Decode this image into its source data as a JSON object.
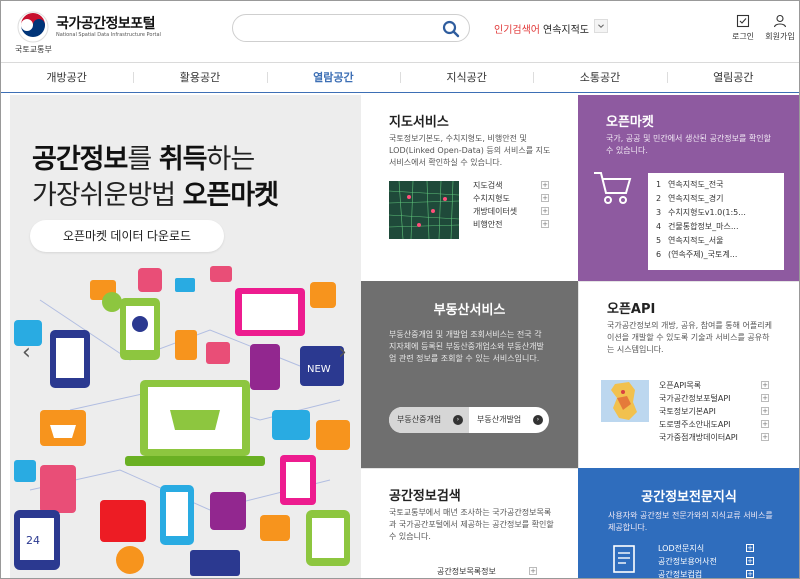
{
  "header": {
    "ministry": "국토교통부",
    "title": "국가공간정보포털",
    "subtitle": "National Spatial Data Infrastructure Portal",
    "search_value": "",
    "popular_label": "인기검색어",
    "popular_value": "연속지적도",
    "login_label": "로그인",
    "join_label": "회원가입"
  },
  "nav": [
    "개방공간",
    "활용공간",
    "열람공간",
    "지식공간",
    "소통공간",
    "열림공간"
  ],
  "hero": {
    "line1_bold1": "공간정보",
    "line1_rest1": "를 ",
    "line1_bold2": "취득",
    "line1_rest2": "하는",
    "line2_rest": "가장쉬운방법 ",
    "line2_bold": "오픈마켓",
    "button": "오픈마켓 데이터 다운로드",
    "prev": "‹",
    "next": "›"
  },
  "map_service": {
    "title": "지도서비스",
    "desc": "국토정보기본도, 수치지형도, 비행안전 및 LOD(Linked Open-Data) 등의 서비스를 지도서비스에서 확인하실 수 있습니다.",
    "links": [
      "지도검색",
      "수치지형도",
      "개방데이터셋",
      "비행안전"
    ]
  },
  "open_market": {
    "title": "오픈마켓",
    "desc": "국가, 공공 및 민간에서 생산된 공간정보를 확인할 수 있습니다.",
    "ranks": [
      {
        "num": "1",
        "label": "연속지적도_전국"
      },
      {
        "num": "2",
        "label": "연속지적도_경기"
      },
      {
        "num": "3",
        "label": "수치지형도v1.0(1:5..."
      },
      {
        "num": "4",
        "label": "건물통합정보_마스..."
      },
      {
        "num": "5",
        "label": "연속지적도_서울"
      },
      {
        "num": "6",
        "label": "(연속주제)_국토계..."
      }
    ]
  },
  "real_estate": {
    "title": "부동산서비스",
    "desc": "부동산중개업 및 개발업 조회서비스는 전국 각 지자체에 등록된 부동산중개업소와 부동산개발업 관련 정보를 조회할 수 있는 서비스입니다.",
    "btn1": "부동산중개업",
    "btn2": "부동산개발업"
  },
  "open_api": {
    "title": "오픈API",
    "desc": "국가공간정보의 개방, 공유, 참여를 통해 어플리케이션을 개발할 수 있도록 기술과 서비스를 공유하는 시스템입니다.",
    "links": [
      "오픈API목록",
      "국가공간정보포털API",
      "국토정보기본API",
      "도로명주소안내도API",
      "국가중점개방데이터API"
    ]
  },
  "spatial_search": {
    "title": "공간정보검색",
    "desc": "국토교통부에서 매년 조사하는 국가공간정보목록과 국가공간포털에서 제공하는 공간정보를 확인할 수 있습니다.",
    "links": [
      "공간정보목록정보"
    ]
  },
  "expert": {
    "title": "공간정보전문지식",
    "desc": "사용자와 공간정보 전문가와의 지식교류 서비스를 제공합니다.",
    "links": [
      "LOD전문지식",
      "공간정보용어사전",
      "공간정보컴컴"
    ]
  },
  "colors": {
    "accent_blue": "#3d6fb5",
    "purple": "#8e5aa0",
    "gray": "#6f6f6f",
    "blue": "#2f6dbd",
    "popular_red": "#e13a3a"
  }
}
